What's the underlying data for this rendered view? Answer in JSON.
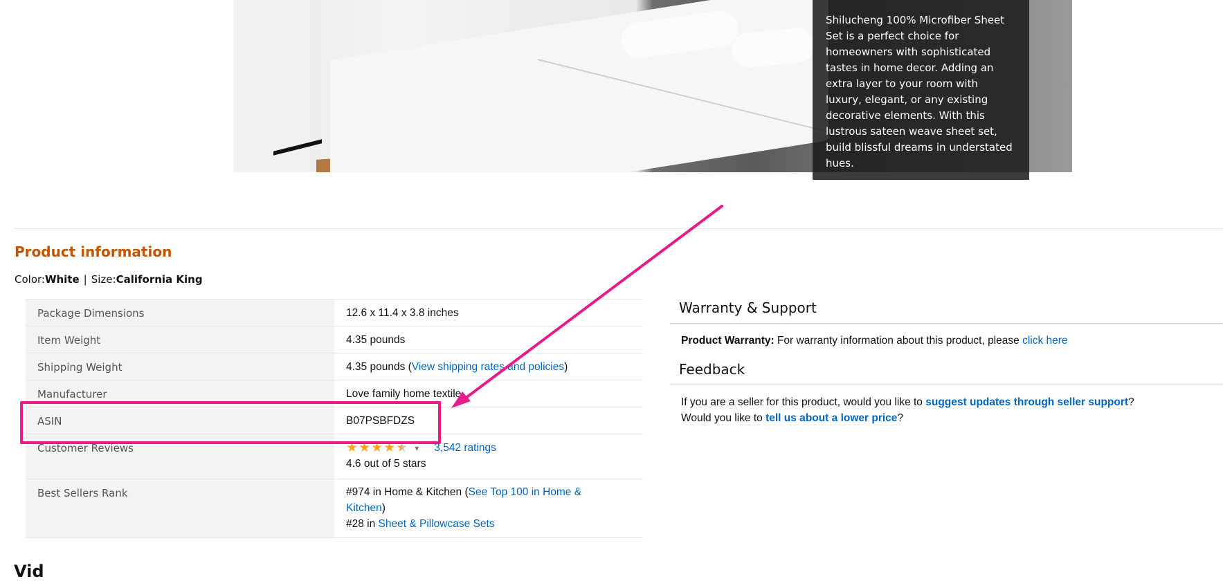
{
  "hero": {
    "overlay_text": "Shilucheng 100% Microfiber Sheet Set is a perfect choice for homeowners with sophisticated tastes in home decor. Adding an extra layer to your room with luxury, elegant, or any existing decorative elements. With this lustrous sateen weave sheet set, build blissful dreams in understated hues."
  },
  "product_info": {
    "title": "Product information",
    "color_label": "Color:",
    "color_value": "White",
    "separator": "|",
    "size_label": "Size:",
    "size_value": "California King",
    "rows": [
      {
        "label": "Package Dimensions",
        "value": "12.6 x 11.4 x 3.8 inches"
      },
      {
        "label": "Item Weight",
        "value": "4.35 pounds"
      },
      {
        "label": "Shipping Weight",
        "value_prefix": "4.35 pounds (",
        "link": "View shipping rates and policies",
        "value_suffix": ")"
      },
      {
        "label": "Manufacturer",
        "value": "Love family home textile"
      },
      {
        "label": "ASIN",
        "value": "B07PSBFDZS"
      },
      {
        "label": "Customer Reviews",
        "ratings_link": "3,542 ratings",
        "rating_text": "4.6 out of 5 stars",
        "rating": 4.6
      },
      {
        "label": "Best Sellers Rank",
        "rank1_prefix": "#974 in Home & Kitchen (",
        "rank1_link": "See Top 100 in Home & Kitchen",
        "rank1_suffix": ")",
        "rank2_prefix": "#28 in ",
        "rank2_link": "Sheet & Pillowcase Sets"
      }
    ]
  },
  "warranty": {
    "title": "Warranty & Support",
    "label": "Product Warranty:",
    "text": "For warranty information about this product, please",
    "link": "click here"
  },
  "feedback": {
    "title": "Feedback",
    "line1_prefix": "If you are a seller for this product, would you like to",
    "line1_link": "suggest updates through seller support",
    "line1_suffix": "?",
    "line2_prefix": "Would you like to",
    "line2_link": "tell us about a lower price",
    "line2_suffix": "?"
  },
  "next_section": {
    "title": "Vid"
  },
  "annotation": {
    "color": "#ea1a8a"
  }
}
